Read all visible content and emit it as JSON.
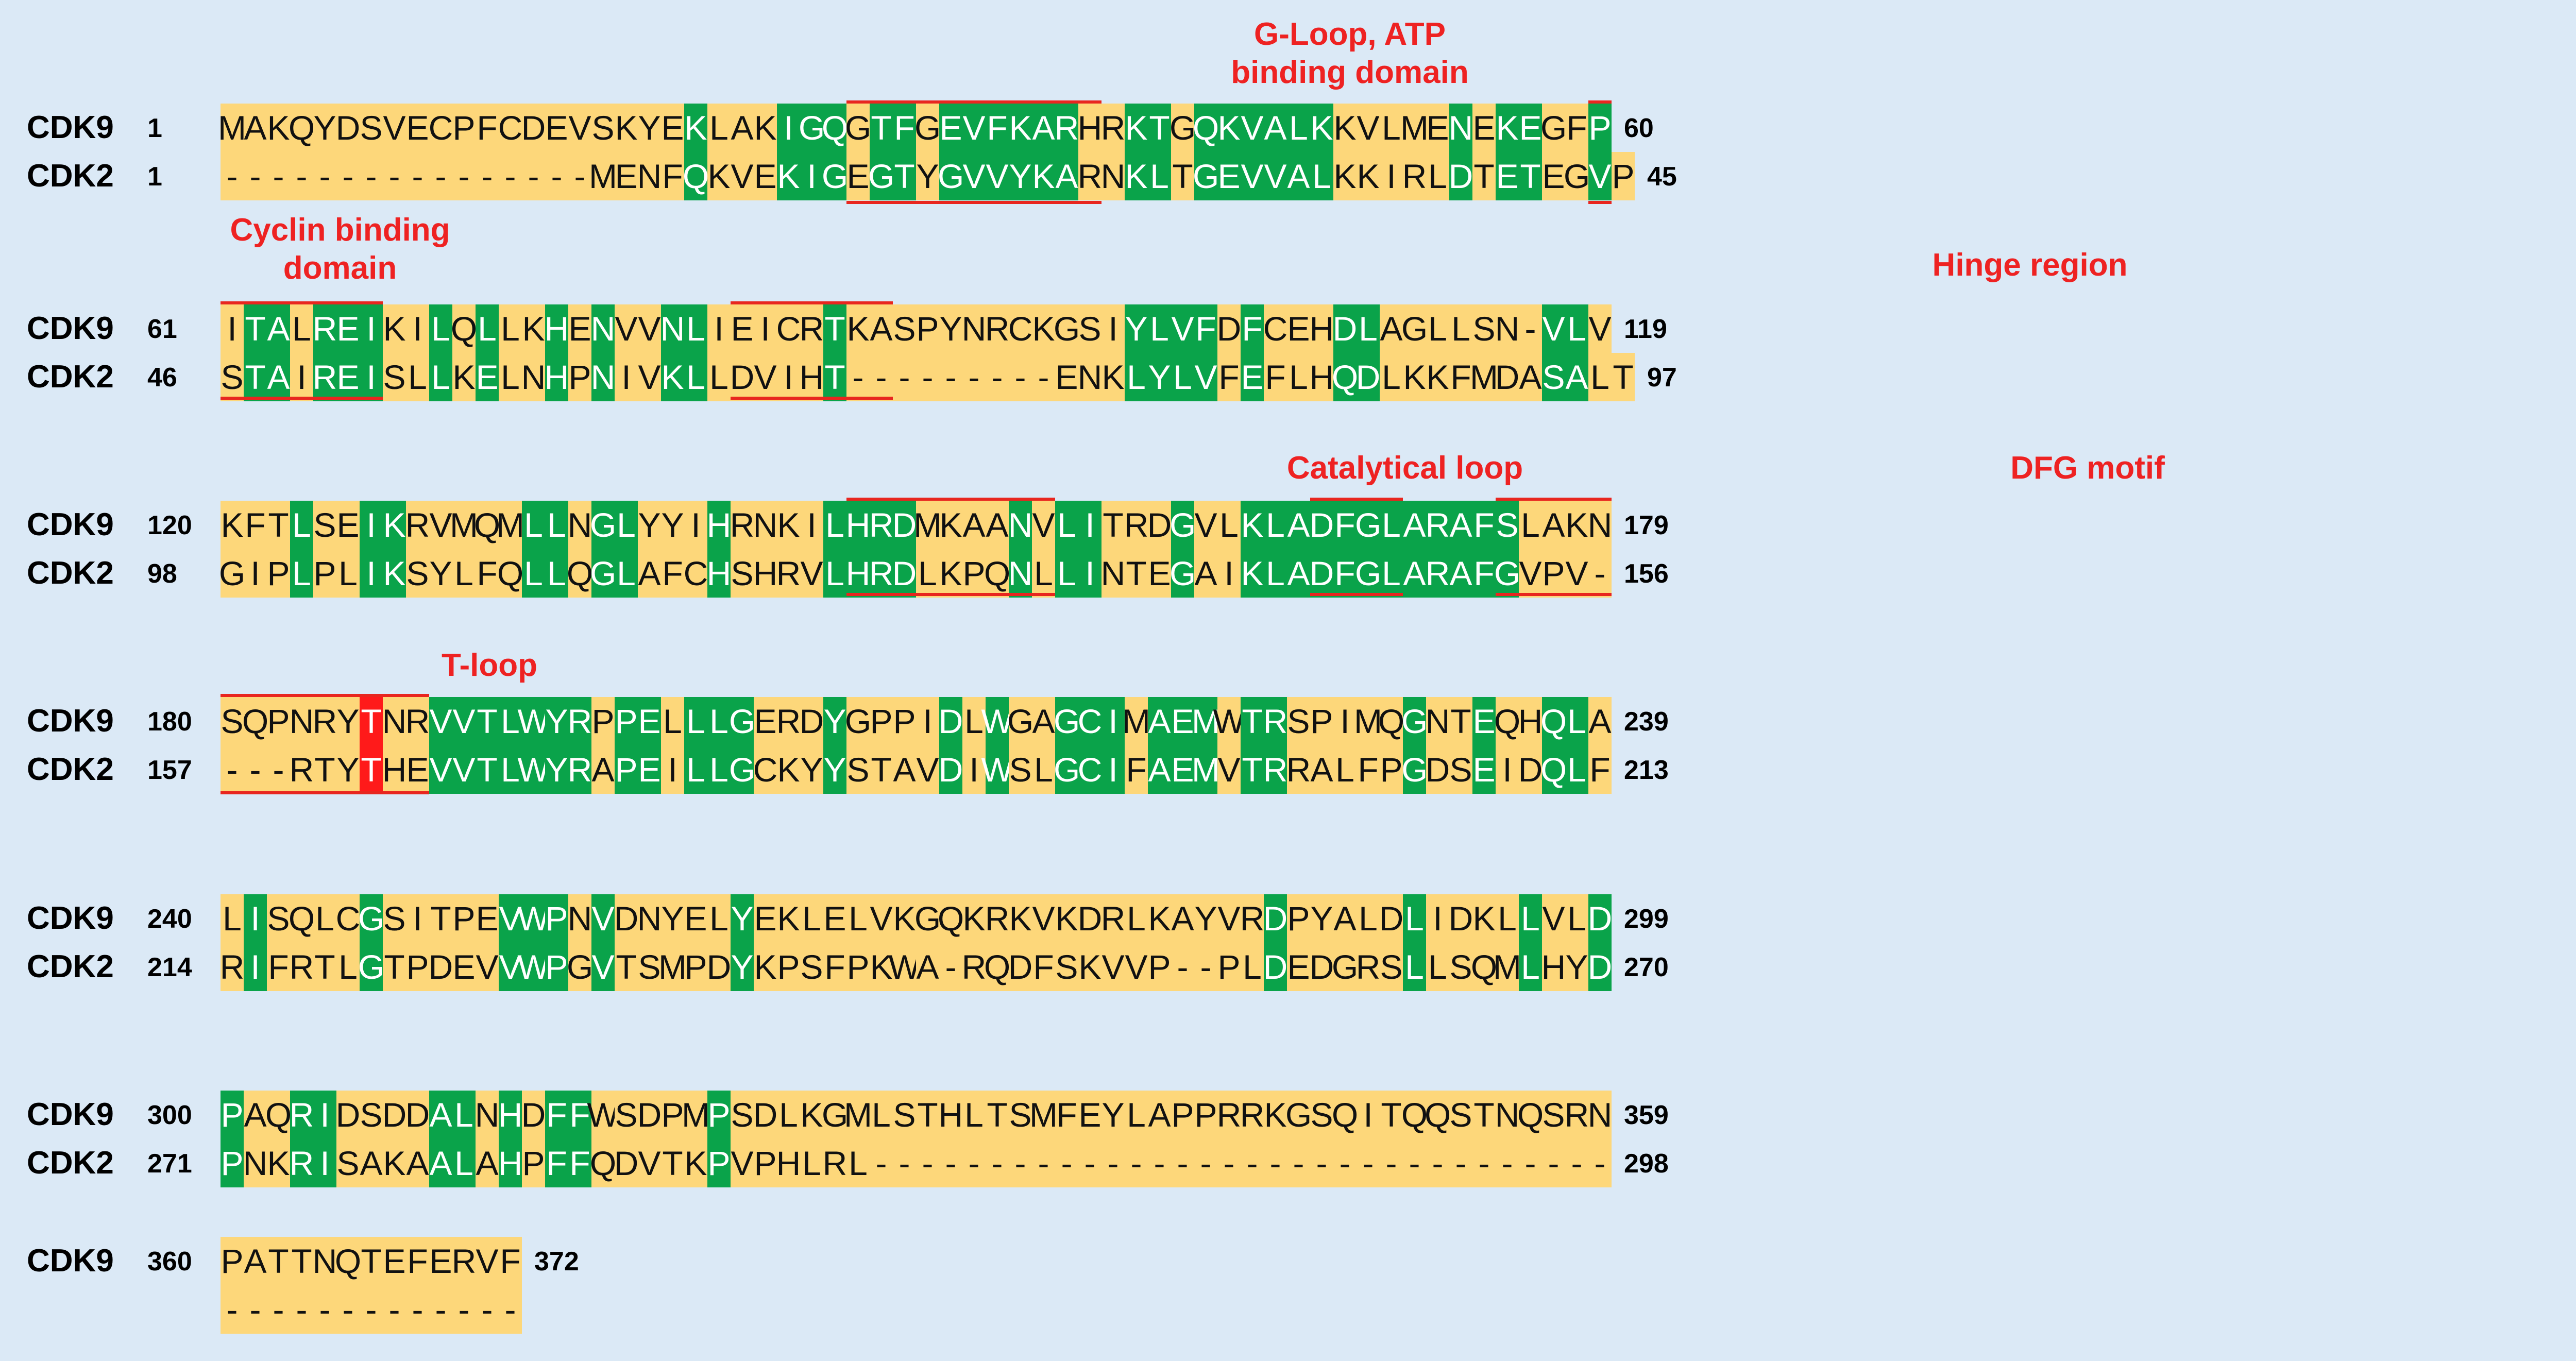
{
  "sequence_names": {
    "top": "CDK9",
    "bottom": "CDK2"
  },
  "rows": [
    {
      "cdk9_start": "1",
      "cdk9_end": "60",
      "cdk2_start": "1",
      "cdk2_end": "45",
      "cdk9": "MAKQYDSVECPFCDEVSKYEKLAKIGQGTFGEVFKARHRKTGQKVALKKVLMENEKEGFP",
      "cdk2": "----------------MENFQKVEKIGEGTYGVVYKARNKLTGEVVALKKIRLDTETEGVP",
      "green": [
        20,
        24,
        25,
        26,
        28,
        29,
        31,
        32,
        33,
        34,
        35,
        36,
        39,
        40,
        42,
        43,
        44,
        45,
        46,
        47,
        53,
        55,
        56,
        59
      ],
      "red": []
    },
    {
      "cdk9_start": "61",
      "cdk9_end": "119",
      "cdk2_start": "46",
      "cdk2_end": "97",
      "cdk9": "ITALREIKILQLLKHENVVNLIEICRTKASPYNRCKGSIYLVFDFCEHDLAGLLSN-VLV",
      "cdk2": "STAIREISLLKELNHPNIVKLLDVIHT---------ENKLYLVFEFLHQDLKKFMDASALT",
      "green": [
        1,
        2,
        4,
        5,
        6,
        9,
        11,
        14,
        16,
        19,
        20,
        26,
        39,
        40,
        41,
        42,
        44,
        48,
        49,
        57,
        58
      ],
      "red": []
    },
    {
      "cdk9_start": "120",
      "cdk9_end": "179",
      "cdk2_start": "98",
      "cdk2_end": "156",
      "cdk9": "KFTLSEIKRVMQMLLNGLYYIHRNKILHRDMKAANVLITRDGVLKLADFGLARAFSLAKN",
      "cdk2": "GIPLPLIKSYLFQLLQGLAFCHSHRVLHRDLKPQNLLINTEGAIKLADFGLARAFGVPV-",
      "green": [
        3,
        6,
        7,
        13,
        14,
        16,
        17,
        21,
        26,
        27,
        28,
        29,
        34,
        36,
        37,
        41,
        44,
        45,
        46,
        47,
        48,
        49,
        50,
        51,
        52,
        53,
        54,
        55
      ],
      "red": []
    },
    {
      "cdk9_start": "180",
      "cdk9_end": "239",
      "cdk2_start": "157",
      "cdk2_end": "213",
      "cdk9": "SQPNRYTNRVVTLWYRPPELLLGERDYGPPIDLWGAGCIMAEMWTRSPIMQGNTEQHQLA",
      "cdk2": "---RTYTHEVVTLWYRAPEILLGCKYYSTAVDIWSLGCIFAEMVTRRALFPGDSEIDQLF",
      "green": [
        9,
        10,
        11,
        12,
        13,
        14,
        15,
        17,
        18,
        20,
        21,
        22,
        26,
        31,
        33,
        36,
        37,
        38,
        40,
        41,
        42,
        44,
        45,
        51,
        54,
        57,
        58
      ],
      "red": [
        6
      ]
    },
    {
      "cdk9_start": "240",
      "cdk9_end": "299",
      "cdk2_start": "214",
      "cdk2_end": "270",
      "cdk9": "LISQLCGSITPEVWPNVDNYELYEKLELVKGQKRKVKDRLKAYVRDPYALDLIDKLLVLD",
      "cdk2": "RIFRTLGTPDEVVWPGVTSMPDYKPSFPKWA-RQDFSKVVP--PLDEDGRSLLSQMLHYD",
      "green": [
        1,
        6,
        12,
        13,
        14,
        16,
        22,
        45,
        51,
        56,
        59
      ],
      "red": []
    },
    {
      "cdk9_start": "300",
      "cdk9_end": "359",
      "cdk2_start": "271",
      "cdk2_end": "298",
      "cdk9": "PAQRIDSDDALNHDFFWSDPMPSDLKGMLSTHLTSMFEYLAPPRRKGSQITQQSTNQSRN",
      "cdk2": "PNKRISAKAALAHPFFQDVTKPVPHLRL--------------------------------",
      "green": [
        0,
        3,
        4,
        9,
        10,
        12,
        14,
        15,
        21
      ],
      "red": []
    },
    {
      "cdk9_start": "360",
      "cdk9_end": "372",
      "cdk2_start": "",
      "cdk2_end": "",
      "cdk9": "PATTNQTEFERVF",
      "cdk2": "-------------",
      "green": [],
      "red": []
    }
  ],
  "annotations": [
    {
      "text": "G-Loop, ATP\nbinding domain"
    },
    {
      "text": "Cyclin binding\ndomain"
    },
    {
      "text": "Hinge region"
    },
    {
      "text": "Catalytical loop"
    },
    {
      "text": "DFG motif"
    },
    {
      "text": "T-loop"
    }
  ],
  "colors": {
    "background": "#dbe9f6",
    "base": "#fdd77a",
    "conserved": "#0aa34a",
    "highlight": "#ff1a1a",
    "annotation": "#ee2222"
  }
}
